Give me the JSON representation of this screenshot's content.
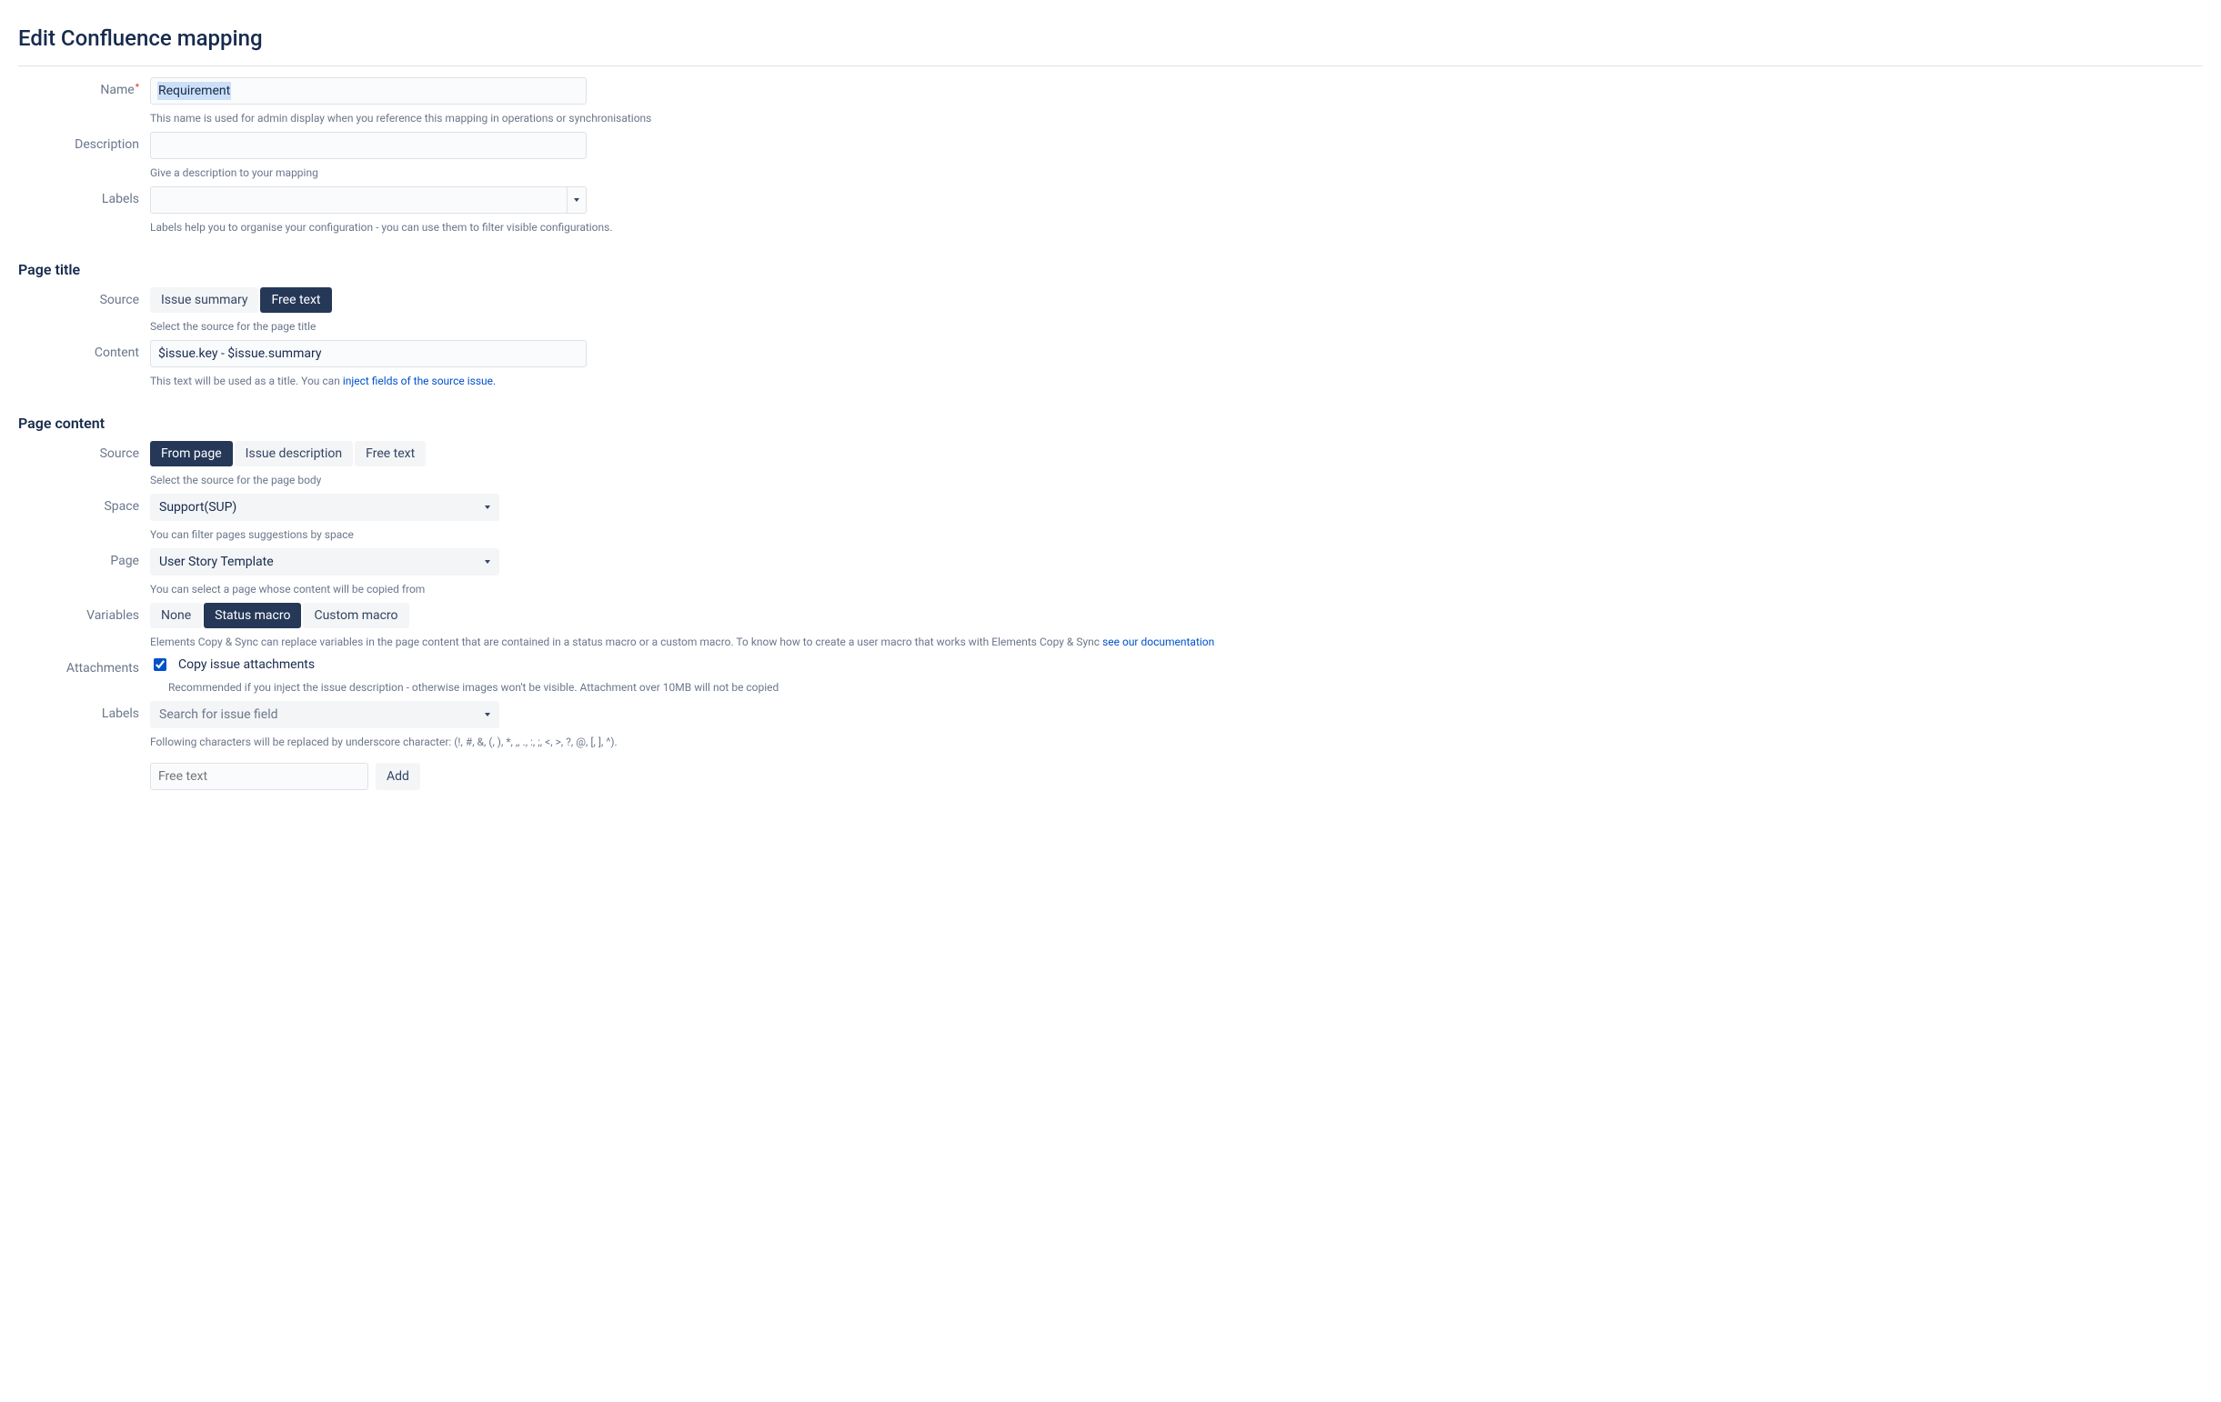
{
  "page": {
    "title": "Edit Confluence mapping"
  },
  "sections": {
    "title_section": "Page title",
    "content_section": "Page content"
  },
  "fields": {
    "name": {
      "label": "Name",
      "required": true,
      "value": "Requirement",
      "help": "This name is used for admin display when you reference this mapping in operations or synchronisations"
    },
    "description": {
      "label": "Description",
      "value": "",
      "help": "Give a description to your mapping"
    },
    "labels": {
      "label": "Labels",
      "value": "",
      "help": "Labels help you to organise your configuration - you can use them to filter visible configurations."
    },
    "title_source": {
      "label": "Source",
      "options": [
        "Issue summary",
        "Free text"
      ],
      "selected": "Free text",
      "help": "Select the source for the page title"
    },
    "title_content": {
      "label": "Content",
      "value": "$issue.key - $issue.summary",
      "help_prefix": "This text will be used as a title. You can ",
      "help_link": "inject fields of the source issue."
    },
    "content_source": {
      "label": "Source",
      "options": [
        "From page",
        "Issue description",
        "Free text"
      ],
      "selected": "From page",
      "help": "Select the source for the page body"
    },
    "space": {
      "label": "Space",
      "value": "Support(SUP)",
      "help": "You can filter pages suggestions by space"
    },
    "page": {
      "label": "Page",
      "value": "User Story Template",
      "help": "You can select a page whose content will be copied from"
    },
    "variables": {
      "label": "Variables",
      "options": [
        "None",
        "Status macro",
        "Custom macro"
      ],
      "selected": "Status macro",
      "help_prefix": "Elements Copy & Sync can replace variables in the page content that are contained in a status macro or a custom macro. To know how to create a user macro that works with Elements Copy & Sync ",
      "help_link": "see our documentation"
    },
    "attachments": {
      "label": "Attachments",
      "checked": true,
      "checkbox_label": "Copy issue attachments",
      "help": "Recommended if you inject the issue description - otherwise images won't be visible. Attachment over 10MB will not be copied"
    },
    "content_labels": {
      "label": "Labels",
      "placeholder": "Search for issue field",
      "help": "Following characters will be replaced by underscore character: (!, #, &, (, ), *, ,, ., :, ;, <, >, ?, @, [, ], ^)."
    },
    "free_text": {
      "placeholder": "Free text",
      "button": "Add"
    }
  }
}
